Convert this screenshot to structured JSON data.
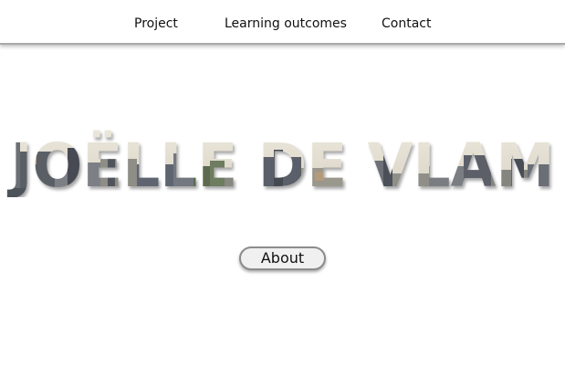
{
  "nav": {
    "items": [
      {
        "label": "Project"
      },
      {
        "label": "Learning outcomes"
      },
      {
        "label": "Contact"
      }
    ]
  },
  "hero": {
    "title": "JOËLLE DE VLAM",
    "fill_colors": {
      "sky": "#e6e2d6",
      "buildings_dark": "#4a4f58",
      "buildings_mid": "#8a8c88",
      "trees": "#5d6b4f",
      "warm": "#b59a7a"
    }
  },
  "about_button": {
    "label": "About"
  },
  "colors": {
    "nav_border": "#a9a9a9",
    "button_bg": "#f0f0f0",
    "button_border": "#8c8c8c",
    "text": "#111111"
  }
}
